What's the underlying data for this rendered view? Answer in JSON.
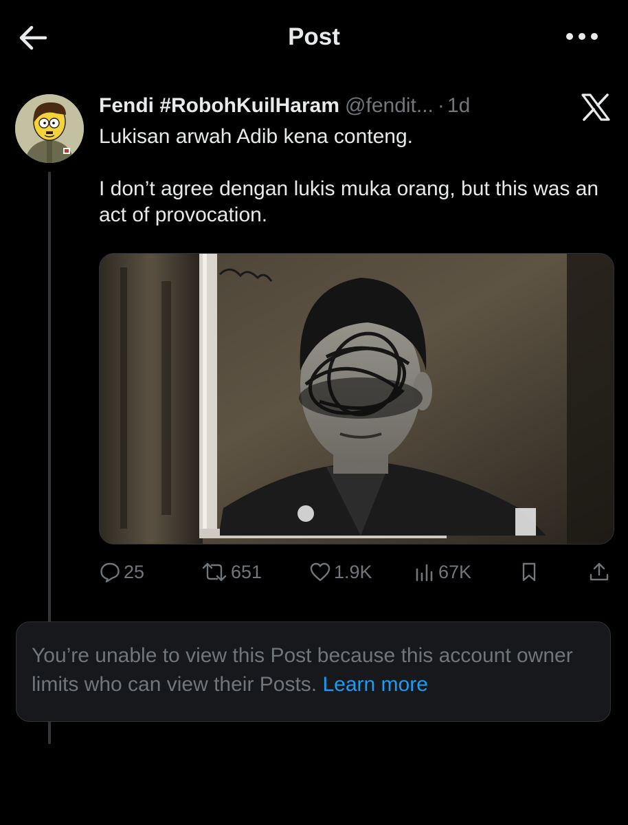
{
  "header": {
    "title": "Post"
  },
  "post": {
    "author": {
      "display_name": "Fendi #RobohKuilHaram",
      "handle": "@fendit...",
      "separator": "·",
      "time_ago": "1d"
    },
    "text_lines": [
      "Lukisan arwah Adib kena conteng.",
      "I don’t agree dengan lukis muka orang, but this was an act of provocation."
    ],
    "stats": {
      "replies": "25",
      "reposts": "651",
      "likes": "1.9K",
      "views": "67K"
    }
  },
  "notice": {
    "text": "You’re unable to view this Post because this account owner limits who can view their Posts.",
    "link_label": "Learn more"
  },
  "colors": {
    "background": "#000000",
    "primary_text": "#e7e9ea",
    "secondary_text": "#71767b",
    "link": "#1d9bf0",
    "card_background": "#16181c",
    "border": "#2f3336"
  },
  "icons": [
    "arrow-left-icon",
    "more-horizontal-icon",
    "x-logo-icon",
    "reply-icon",
    "repost-icon",
    "like-icon",
    "views-icon",
    "bookmark-icon",
    "share-icon"
  ]
}
